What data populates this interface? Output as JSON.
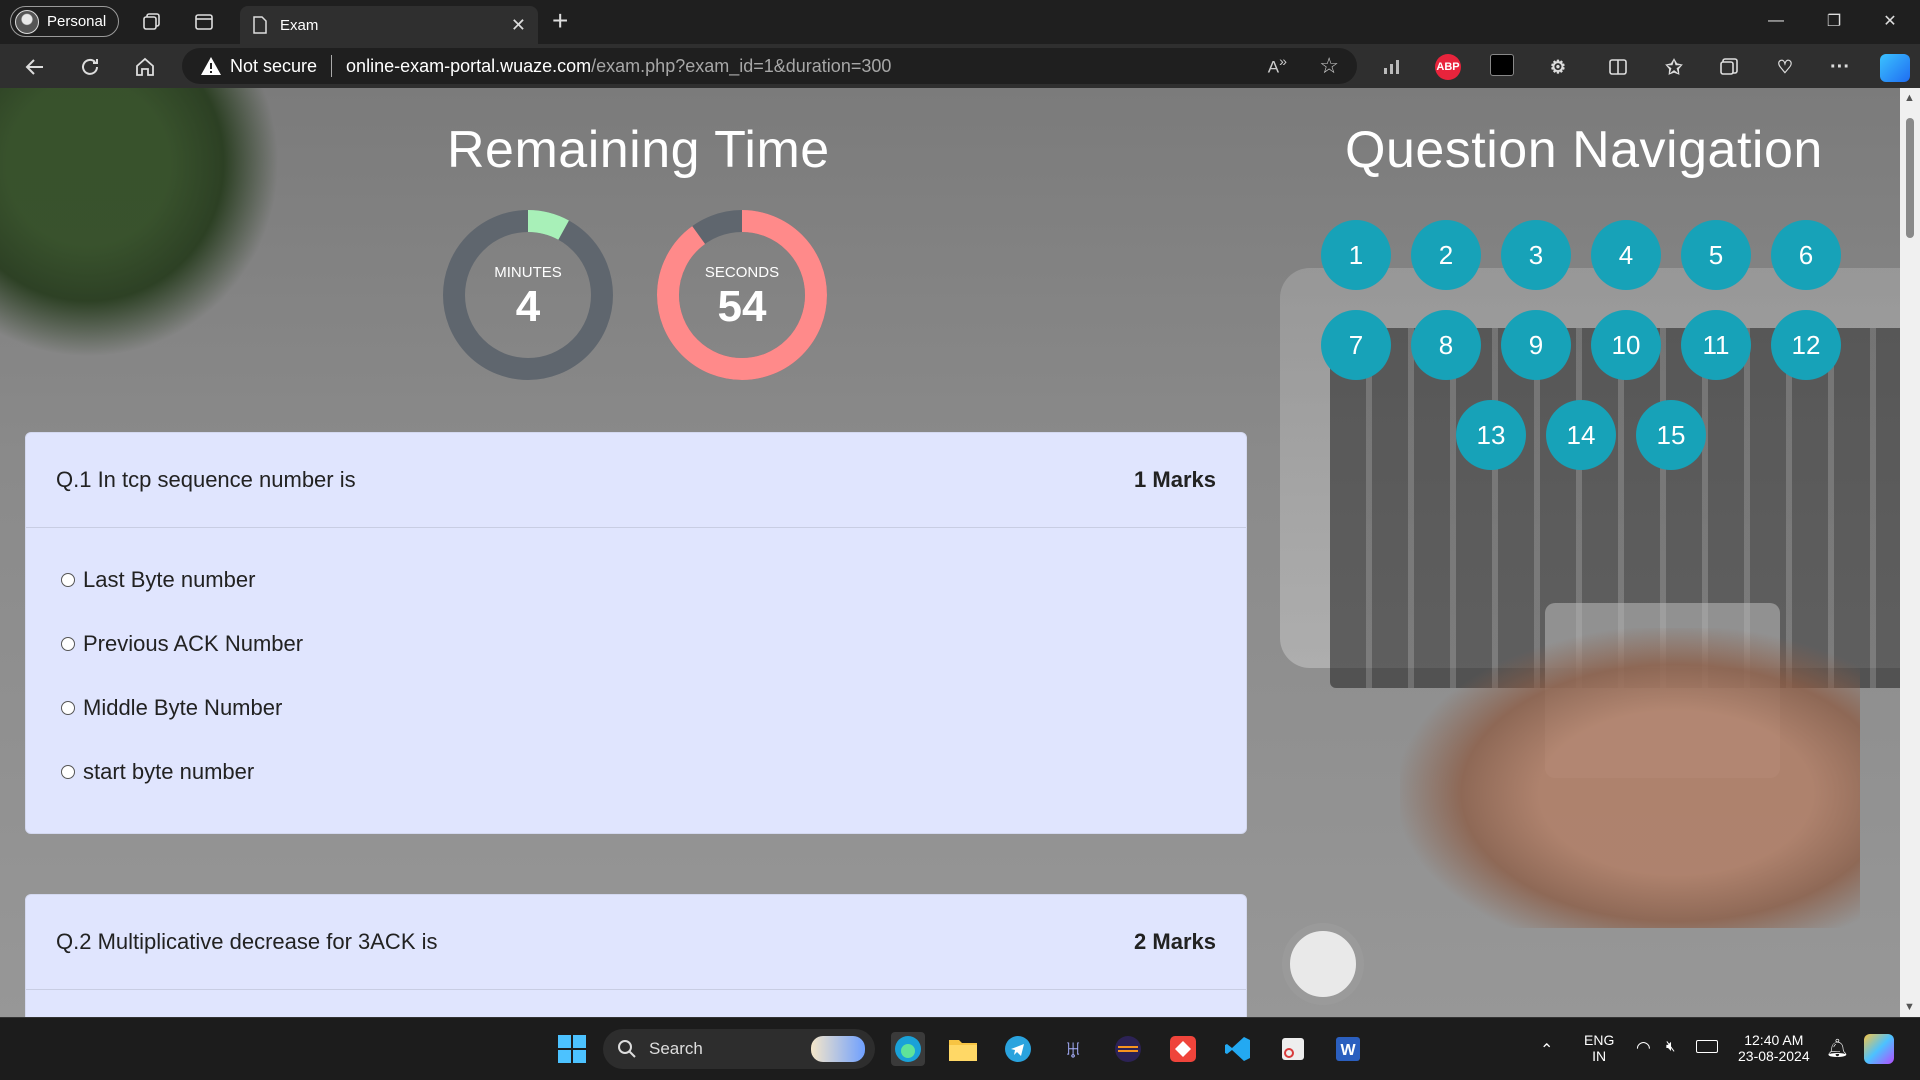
{
  "browser": {
    "profile_label": "Personal",
    "tab_title": "Exam",
    "address": {
      "security_label": "Not secure",
      "host": "online-exam-portal.wuaze.com",
      "path": "/exam.php?exam_id=1&duration=300"
    },
    "extensions": [
      {
        "name": "abp-icon",
        "label": "ABP",
        "color": "#e8243c"
      }
    ]
  },
  "timer": {
    "title": "Remaining Time",
    "minutes_label": "MINUTES",
    "minutes_value": "4",
    "minutes_fraction": 0.08,
    "seconds_label": "SECONDS",
    "seconds_value": "54",
    "seconds_fraction": 0.9,
    "minutes_color": "#a8f0b8",
    "seconds_color": "#ff8a8a",
    "track_color": "#5f666e"
  },
  "navigation": {
    "title": "Question Navigation",
    "questions": [
      "1",
      "2",
      "3",
      "4",
      "5",
      "6",
      "7",
      "8",
      "9",
      "10",
      "11",
      "12",
      "13",
      "14",
      "15"
    ],
    "button_color": "#17a2b8"
  },
  "questions": [
    {
      "text": "Q.1 In tcp sequence number is",
      "marks": "1 Marks",
      "options": [
        "Last Byte number",
        "Previous ACK Number",
        "Middle Byte Number",
        "start byte number"
      ]
    },
    {
      "text": "Q.2 Multiplicative decrease for 3ACK is",
      "marks": "2 Marks"
    }
  ],
  "taskbar": {
    "search_label": "Search",
    "language_primary": "ENG",
    "language_secondary": "IN",
    "time": "12:40 AM",
    "date": "23-08-2024"
  }
}
